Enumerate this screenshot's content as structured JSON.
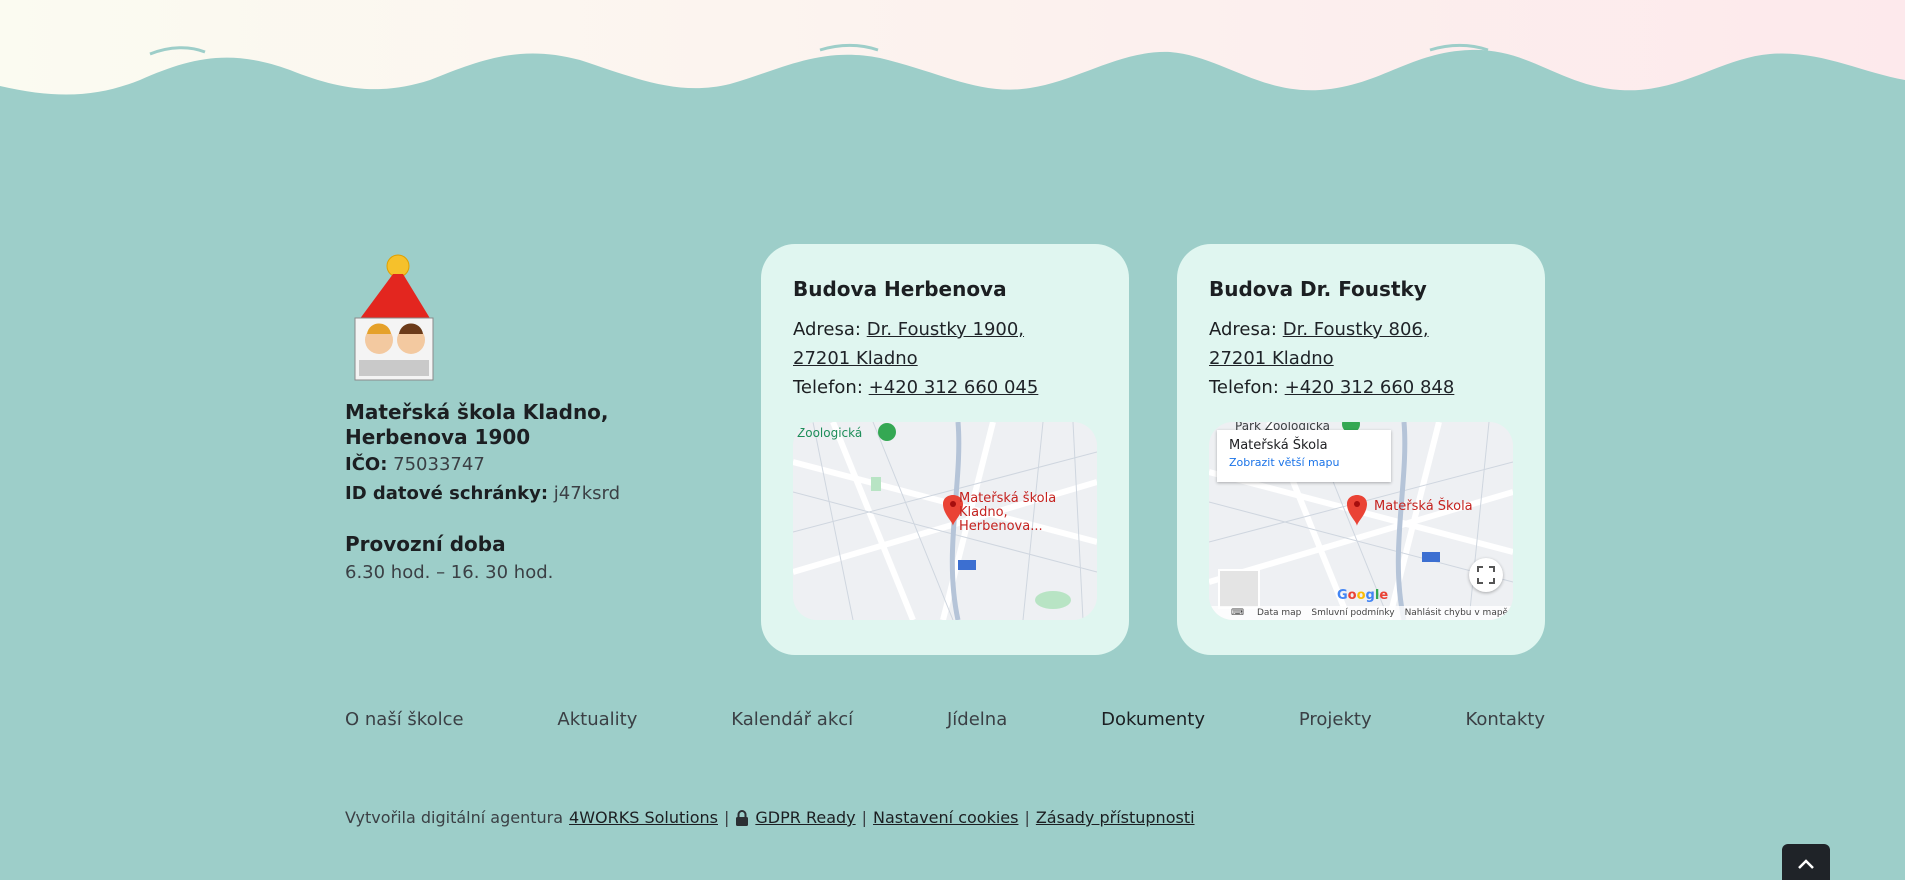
{
  "school": {
    "name": "Mateřská škola Kladno, Herbenova 1900",
    "ico_label": "IČO:",
    "ico_value": "75033747",
    "databox_label": "ID datové schránky:",
    "databox_value": "j47ksrd",
    "hours_title": "Provozní doba",
    "hours_value": "6.30 hod. – 16. 30 hod.",
    "logo_text": "7. a 29. MŠ KLADNO"
  },
  "buildings": [
    {
      "title": "Budova Herbenova",
      "address_label": "Adresa:",
      "address_line1": "Dr. Foustky 1900,",
      "address_line2": "27201 Kladno",
      "phone_label": "Telefon:",
      "phone": "+420 312 660 045",
      "map_marker": "Mateřská škola Kladno, Herbenova...",
      "map_poi": "Zoologická"
    },
    {
      "title": "Budova Dr. Foustky",
      "address_label": "Adresa:",
      "address_line1": "Dr. Foustky 806,",
      "address_line2": "27201 Kladno",
      "phone_label": "Telefon:",
      "phone": "+420 312 660 848",
      "map_marker": "Mateřská Škola",
      "map_poi": "Park Zoologická",
      "popup_title": "Mateřská Škola",
      "popup_link": "Zobrazit větší mapu",
      "map_footer": [
        "Data map",
        "Smluvní podmínky",
        "Nahlásit chybu v mapě"
      ]
    }
  ],
  "nav": [
    {
      "label": "O naší školce",
      "active": false
    },
    {
      "label": "Aktuality",
      "active": false
    },
    {
      "label": "Kalendář akcí",
      "active": false
    },
    {
      "label": "Jídelna",
      "active": false
    },
    {
      "label": "Dokumenty",
      "active": true
    },
    {
      "label": "Projekty",
      "active": false
    },
    {
      "label": "Kontakty",
      "active": false
    }
  ],
  "credits": {
    "prefix": "Vytvořila digitální agentura",
    "agency": "4WORKS Solutions",
    "gdpr": "GDPR Ready",
    "cookies": "Nastavení cookies",
    "accessibility": "Zásady přístupnosti",
    "sep": "|"
  },
  "colors": {
    "background": "#9dcec9",
    "card": "#e0f6f0",
    "marker": "#ea4335"
  },
  "icons": [
    "lock-icon",
    "chevron-up-icon",
    "fullscreen-icon",
    "map-pin-icon",
    "keyboard-icon"
  ]
}
